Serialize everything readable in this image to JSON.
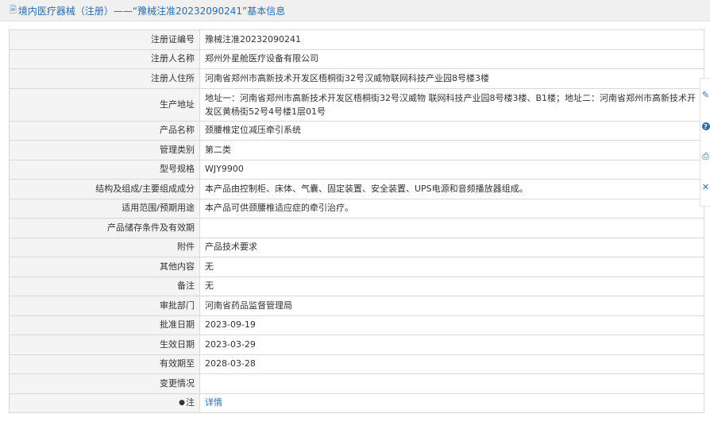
{
  "header": {
    "title": "境内医疗器械（注册）——“豫械注准20232090241”基本信息",
    "icon": "document-icon"
  },
  "rows": [
    {
      "label": "注册证编号",
      "value": "豫械注准20232090241"
    },
    {
      "label": "注册人名称",
      "value": "郑州外星舱医疗设备有限公司"
    },
    {
      "label": "注册人住所",
      "value": "河南省郑州市高新技术开发区梧桐街32号汉威物联网科技产业园8号楼3楼"
    },
    {
      "label": "生产地址",
      "value": "地址一：河南省郑州市高新技术开发区梧桐街32号汉威物 联网科技产业园8号楼3楼、B1楼；地址二：河南省郑州市高新技术开发区黄杨街52号4号楼1层01号"
    },
    {
      "label": "产品名称",
      "value": "颈腰椎定位减压牵引系统"
    },
    {
      "label": "管理类别",
      "value": "第二类"
    },
    {
      "label": "型号规格",
      "value": "WJY9900"
    },
    {
      "label": "结构及组成/主要组成成分",
      "value": "本产品由控制柜、床体、气囊、固定装置、安全装置、UPS电源和音频播放器组成。"
    },
    {
      "label": "适用范围/预期用途",
      "value": "本产品可供颈腰椎适应症的牵引治疗。"
    },
    {
      "label": "产品储存条件及有效期",
      "value": ""
    },
    {
      "label": "附件",
      "value": "产品技术要求"
    },
    {
      "label": "其他内容",
      "value": "无"
    },
    {
      "label": "备注",
      "value": "无"
    },
    {
      "label": "审批部门",
      "value": "河南省药品监督管理局"
    },
    {
      "label": "批准日期",
      "value": "2023-09-19"
    },
    {
      "label": "生效日期",
      "value": "2023-03-29"
    },
    {
      "label": "有效期至",
      "value": "2028-03-28"
    },
    {
      "label": "变更情况",
      "value": ""
    }
  ],
  "note_row": {
    "label": "注",
    "link": "详情",
    "icon": "pin-icon"
  },
  "side_tools": [
    "edit-icon",
    "help-icon",
    "print-icon",
    "close-icon"
  ]
}
